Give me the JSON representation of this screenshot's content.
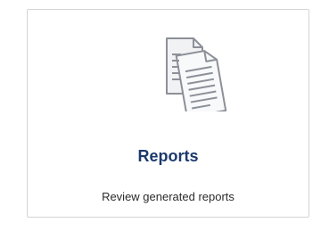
{
  "card": {
    "icon": "document-stack-icon",
    "title": "Reports",
    "description": "Review generated reports",
    "title_color": "#1d3a6b",
    "icon_color": "#8c9098"
  }
}
